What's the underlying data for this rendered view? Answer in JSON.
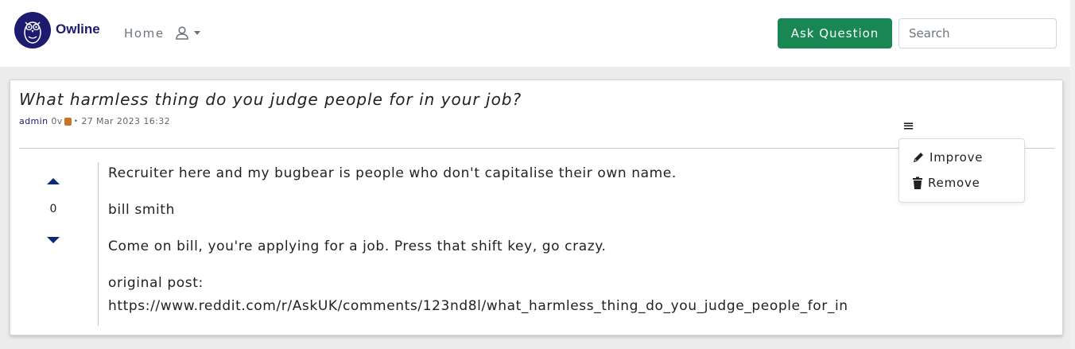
{
  "header": {
    "brand": "Owline",
    "nav_home": "Home",
    "ask_button": "Ask Question",
    "search_placeholder": "Search"
  },
  "question": {
    "title": "What harmless thing do you judge people for in your job?",
    "author": "admin",
    "author_score": "0v",
    "bullet": "•",
    "timestamp": "27 Mar 2023 16:32"
  },
  "menu": {
    "toggle_glyph": "≡",
    "items": [
      {
        "label": "Improve",
        "icon": "pencil-icon"
      },
      {
        "label": "Remove",
        "icon": "trash-icon"
      }
    ]
  },
  "answer": {
    "vote_count": "0",
    "paragraphs": [
      "Recruiter here and my bugbear is people who don't capitalise their own name.",
      "bill smith",
      "Come on bill, you're applying for a job. Press that shift key, go crazy."
    ],
    "source_label": "original post:",
    "source_url": "https://www.reddit.com/r/AskUK/comments/123nd8l/what_harmless_thing_do_you_judge_people_for_in"
  },
  "colors": {
    "brand": "#1d1b6e",
    "ask_button": "#198754",
    "background": "#ececec"
  }
}
